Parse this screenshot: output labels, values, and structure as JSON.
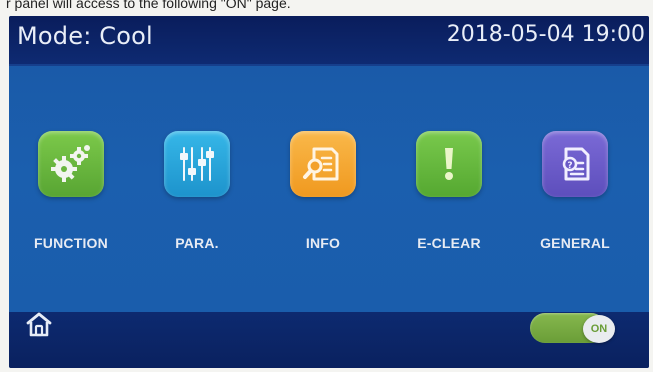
{
  "caption": "r panel will access to the following \"ON\" page.",
  "header": {
    "mode_text": "Mode: Cool",
    "datetime_text": "2018-05-04 19:00"
  },
  "menu": {
    "items": [
      {
        "label": "FUNCTION",
        "icon": "gears-icon",
        "color": "#6dbb3f"
      },
      {
        "label": "PARA.",
        "icon": "sliders-icon",
        "color": "#25a7dc"
      },
      {
        "label": "INFO",
        "icon": "document-search-icon",
        "color": "#f4a532"
      },
      {
        "label": "E-CLEAR",
        "icon": "exclamation-icon",
        "color": "#67bf3e"
      },
      {
        "label": "GENERAL",
        "icon": "document-help-icon",
        "color": "#6a5ac7"
      }
    ]
  },
  "footer": {
    "home_icon": "home-icon",
    "toggle_label": "ON",
    "toggle_color": "#7ab043"
  },
  "colors": {
    "screen_bg": "#1b5fae",
    "bar_bg": "#0d2a70",
    "text": "#e9eef8"
  }
}
